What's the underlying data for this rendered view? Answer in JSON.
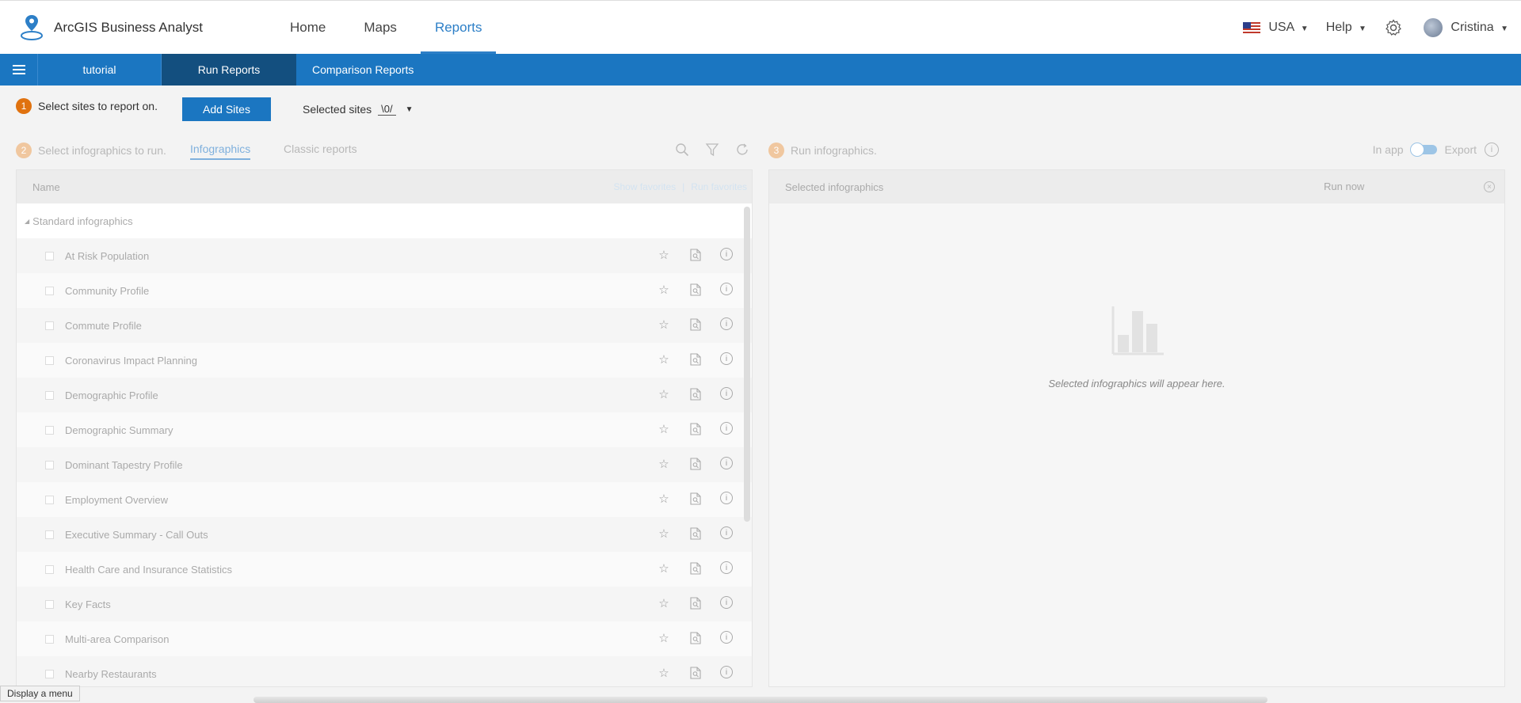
{
  "app": {
    "title": "ArcGIS Business Analyst"
  },
  "topnav": [
    {
      "label": "Home",
      "active": false
    },
    {
      "label": "Maps",
      "active": false
    },
    {
      "label": "Reports",
      "active": true
    }
  ],
  "right_tools": {
    "country": "USA",
    "help": "Help",
    "user": "Cristina"
  },
  "subnav": {
    "tutorial": "tutorial",
    "run_reports": "Run Reports",
    "comparison": "Comparison Reports"
  },
  "step1": {
    "number": "1",
    "text": "Select sites to report on.",
    "add_sites": "Add Sites",
    "selected_sites_label": "Selected sites",
    "selected_count": "0"
  },
  "step2": {
    "number": "2",
    "text": "Select infographics to run.",
    "tab_infographics": "Infographics",
    "tab_classic": "Classic reports"
  },
  "step3": {
    "number": "3",
    "text": "Run infographics.",
    "in_app": "In app",
    "export": "Export"
  },
  "left_panel": {
    "header_name": "Name",
    "show_favorites": "Show favorites",
    "run_favorites": "Run favorites",
    "group": "Standard infographics",
    "items": [
      "At Risk Population",
      "Community Profile",
      "Commute Profile",
      "Coronavirus Impact Planning",
      "Demographic Profile",
      "Demographic Summary",
      "Dominant Tapestry Profile",
      "Employment Overview",
      "Executive Summary - Call Outs",
      "Health Care and Insurance Statistics",
      "Key Facts",
      "Multi-area Comparison",
      "Nearby Restaurants"
    ]
  },
  "right_panel": {
    "header": "Selected infographics",
    "run_now": "Run now",
    "empty_text": "Selected infographics will appear here."
  },
  "status_tooltip": "Display a menu",
  "colors": {
    "primary": "#1b76c1",
    "primary_dark": "#134f7f",
    "accent_orange": "#e0720f"
  }
}
